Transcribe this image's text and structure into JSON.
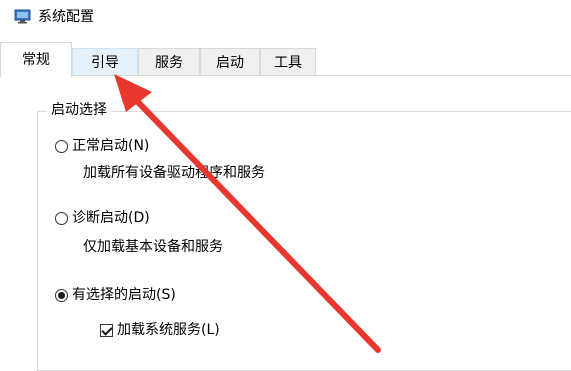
{
  "window": {
    "title": "系统配置",
    "icon": "system-config-icon"
  },
  "tabs": [
    {
      "label": "常规",
      "state": "active"
    },
    {
      "label": "引导",
      "state": "hover"
    },
    {
      "label": "服务",
      "state": "normal"
    },
    {
      "label": "启动",
      "state": "normal"
    },
    {
      "label": "工具",
      "state": "normal"
    }
  ],
  "startup_selection": {
    "label": "启动选择",
    "options": [
      {
        "label": "正常启动(N)",
        "description": "加载所有设备驱动程序和服务",
        "checked": false
      },
      {
        "label": "诊断启动(D)",
        "description": "仅加载基本设备和服务",
        "checked": false
      },
      {
        "label": "有选择的启动(S)",
        "checked": true
      }
    ],
    "selective": {
      "load_system_services": {
        "label": "加载系统服务(L)",
        "checked": true
      }
    }
  },
  "annotation": {
    "type": "arrow",
    "color": "#e8372f",
    "points_to": "tab-boot"
  }
}
